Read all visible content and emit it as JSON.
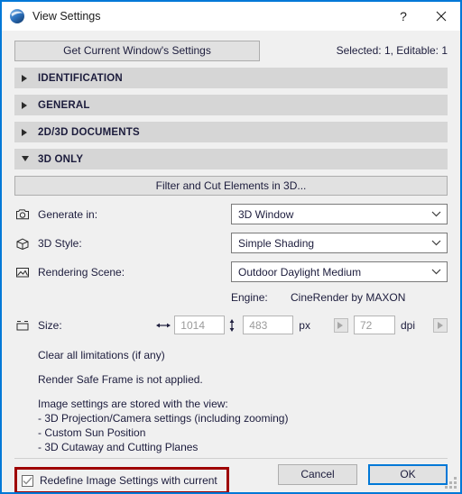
{
  "window": {
    "title": "View Settings",
    "app_icon": "archicad-sphere-icon",
    "help_label": "?",
    "close_label": "✕",
    "accent_color": "#0078d7",
    "highlight_color": "#9e0000"
  },
  "toolbar": {
    "get_settings_label": "Get Current Window's Settings",
    "selection_info": "Selected: 1, Editable: 1"
  },
  "sections": [
    {
      "label": "IDENTIFICATION",
      "expanded": false,
      "arrow": "▶"
    },
    {
      "label": "GENERAL",
      "expanded": false,
      "arrow": "▶"
    },
    {
      "label": "2D/3D DOCUMENTS",
      "expanded": false,
      "arrow": "▶"
    },
    {
      "label": "3D ONLY",
      "expanded": true,
      "arrow": "▼"
    }
  ],
  "panel": {
    "filter_button_label": "Filter and Cut Elements in 3D...",
    "fields": [
      {
        "icon": "camera-icon",
        "label": "Generate in:",
        "value": "3D Window"
      },
      {
        "icon": "cube-icon",
        "label": "3D Style:",
        "value": "Simple Shading"
      },
      {
        "icon": "picture-icon",
        "label": "Rendering Scene:",
        "value": "Outdoor Daylight Medium"
      }
    ],
    "engine": {
      "label": "Engine:",
      "value": "CineRender by MAXON"
    },
    "size": {
      "icon": "size-frame-icon",
      "label": "Size:",
      "width_icon": "horizontal-arrow-icon",
      "width_value": "1014",
      "height_icon": "vertical-arrow-icon",
      "height_value": "483",
      "px_unit": "px",
      "dpi_value": "72",
      "dpi_unit": "dpi",
      "spinner_left": "▶",
      "spinner_right": "▶"
    },
    "info_lines": [
      "Clear all limitations (if any)",
      "",
      "Render Safe Frame is not applied.",
      "",
      "Image settings are stored with the view:",
      "- 3D Projection/Camera settings (including zooming)",
      "- Custom Sun Position",
      "- 3D Cutaway and Cutting Planes"
    ],
    "redefine_checkbox": {
      "label": "Redefine Image Settings with current",
      "checked": true
    }
  },
  "footer": {
    "cancel_label": "Cancel",
    "ok_label": "OK"
  }
}
